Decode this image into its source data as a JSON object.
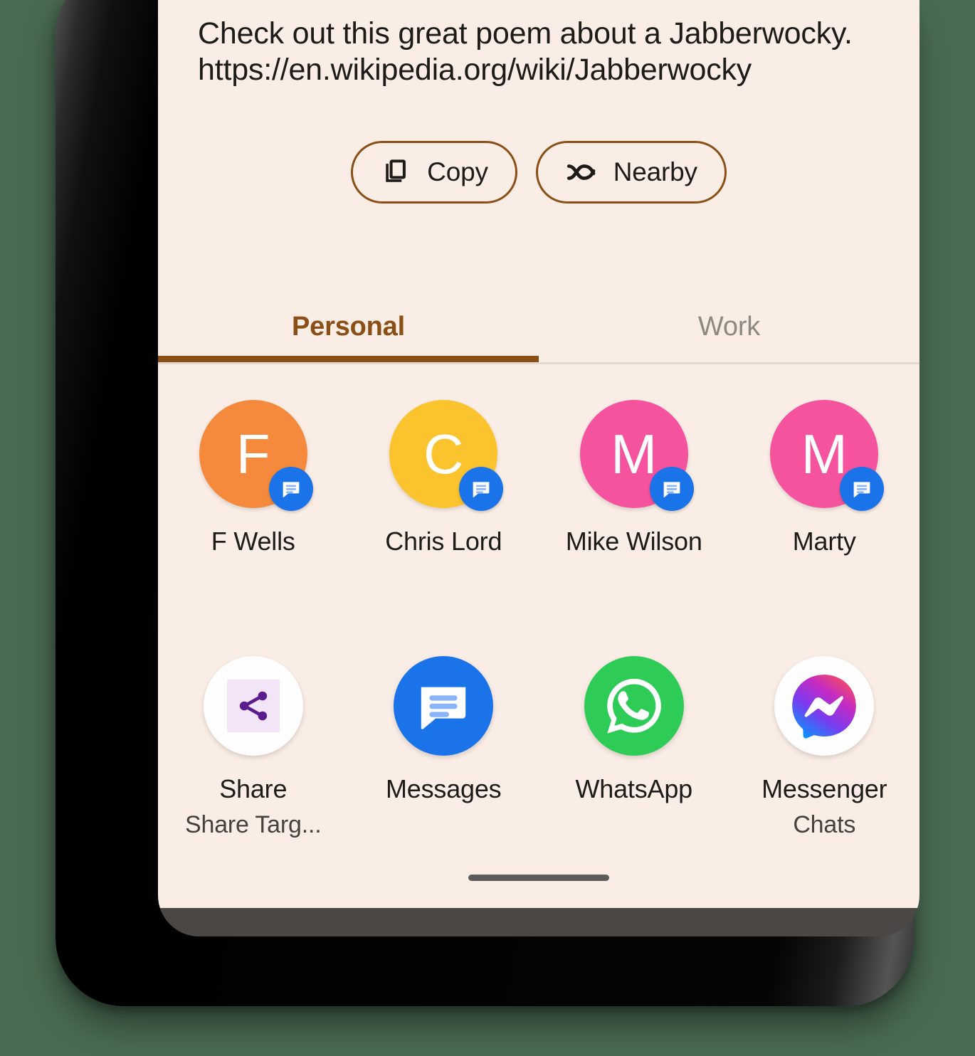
{
  "share_sheet": {
    "drag_handle": "drag-handle",
    "preview": {
      "text": "Check out this great poem about a Jabberwocky.\nhttps://en.wikipedia.org/wiki/Jabberwocky"
    },
    "actions": [
      {
        "id": "copy",
        "label": "Copy",
        "icon": "copy-icon"
      },
      {
        "id": "nearby",
        "label": "Nearby",
        "icon": "nearby-share-icon"
      }
    ],
    "tabs": [
      {
        "id": "personal",
        "label": "Personal",
        "active": true
      },
      {
        "id": "work",
        "label": "Work",
        "active": false
      }
    ],
    "contacts": [
      {
        "name": "F Wells",
        "initial": "F",
        "color": "#F58A3C",
        "badge": "messages-icon"
      },
      {
        "name": "Chris Lord",
        "initial": "C",
        "color": "#FBC42F",
        "badge": "messages-icon"
      },
      {
        "name": "Mike Wilson",
        "initial": "M",
        "color": "#F6539E",
        "badge": "messages-icon"
      },
      {
        "name": "Marty",
        "initial": "M",
        "color": "#F6539E",
        "badge": "messages-icon"
      }
    ],
    "apps": [
      {
        "name": "Share",
        "subtitle": "Share Targ...",
        "icon": "share-icon"
      },
      {
        "name": "Messages",
        "subtitle": "",
        "icon": "messages-icon"
      },
      {
        "name": "WhatsApp",
        "subtitle": "",
        "icon": "whatsapp-icon"
      },
      {
        "name": "Messenger",
        "subtitle": "Chats",
        "icon": "messenger-icon"
      }
    ]
  },
  "colors": {
    "sheet_background": "#FAEDE5",
    "accent_brown": "#8A4F17",
    "inactive_tab": "#8D8880",
    "text_primary": "#1D1B18",
    "badge_blue": "#1A73E8",
    "page_background": "#4A6B52"
  }
}
